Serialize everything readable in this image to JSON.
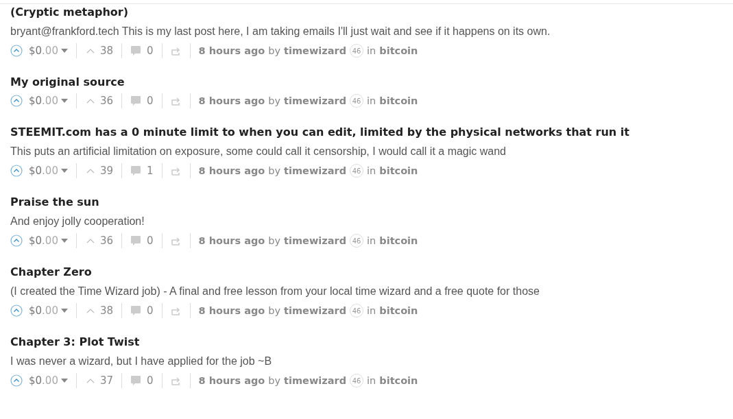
{
  "posts": [
    {
      "title": "(Cryptic metaphor)",
      "body": "bryant@frankford.tech This is my last post here, I am taking emails I'll just wait and see if it happens on its own.",
      "payout_whole": "$0",
      "payout_fraction": ".00",
      "votes": "38",
      "comments": "0",
      "time": "8 hours ago",
      "by": "by",
      "author": "timewizard",
      "reputation": "46",
      "in": "in",
      "category": "bitcoin"
    },
    {
      "title": "My original source",
      "payout_whole": "$0",
      "payout_fraction": ".00",
      "votes": "36",
      "comments": "0",
      "time": "8 hours ago",
      "by": "by",
      "author": "timewizard",
      "reputation": "46",
      "in": "in",
      "category": "bitcoin"
    },
    {
      "title": "STEEMIT.com has a 0 minute limit to when you can edit, limited by the physical networks that run it",
      "body": "This puts an artificial limitation on exposure, some could call it censorship, I would call it a magic wand",
      "payout_whole": "$0",
      "payout_fraction": ".00",
      "votes": "39",
      "comments": "1",
      "time": "8 hours ago",
      "by": "by",
      "author": "timewizard",
      "reputation": "46",
      "in": "in",
      "category": "bitcoin"
    },
    {
      "title": "Praise the sun",
      "body": "And enjoy jolly cooperation!",
      "payout_whole": "$0",
      "payout_fraction": ".00",
      "votes": "36",
      "comments": "0",
      "time": "8 hours ago",
      "by": "by",
      "author": "timewizard",
      "reputation": "46",
      "in": "in",
      "category": "bitcoin"
    },
    {
      "title": "Chapter Zero",
      "body": "(I created the Time Wizard job) - A final and free lesson from your local time wizard and a free quote for those",
      "payout_whole": "$0",
      "payout_fraction": ".00",
      "votes": "38",
      "comments": "0",
      "time": "8 hours ago",
      "by": "by",
      "author": "timewizard",
      "reputation": "46",
      "in": "in",
      "category": "bitcoin"
    },
    {
      "title": "Chapter 3: Plot Twist",
      "body": "I was never a wizard, but I have applied for the job ~B",
      "payout_whole": "$0",
      "payout_fraction": ".00",
      "votes": "37",
      "comments": "0",
      "time": "8 hours ago",
      "by": "by",
      "author": "timewizard",
      "reputation": "46",
      "in": "in",
      "category": "bitcoin"
    }
  ]
}
